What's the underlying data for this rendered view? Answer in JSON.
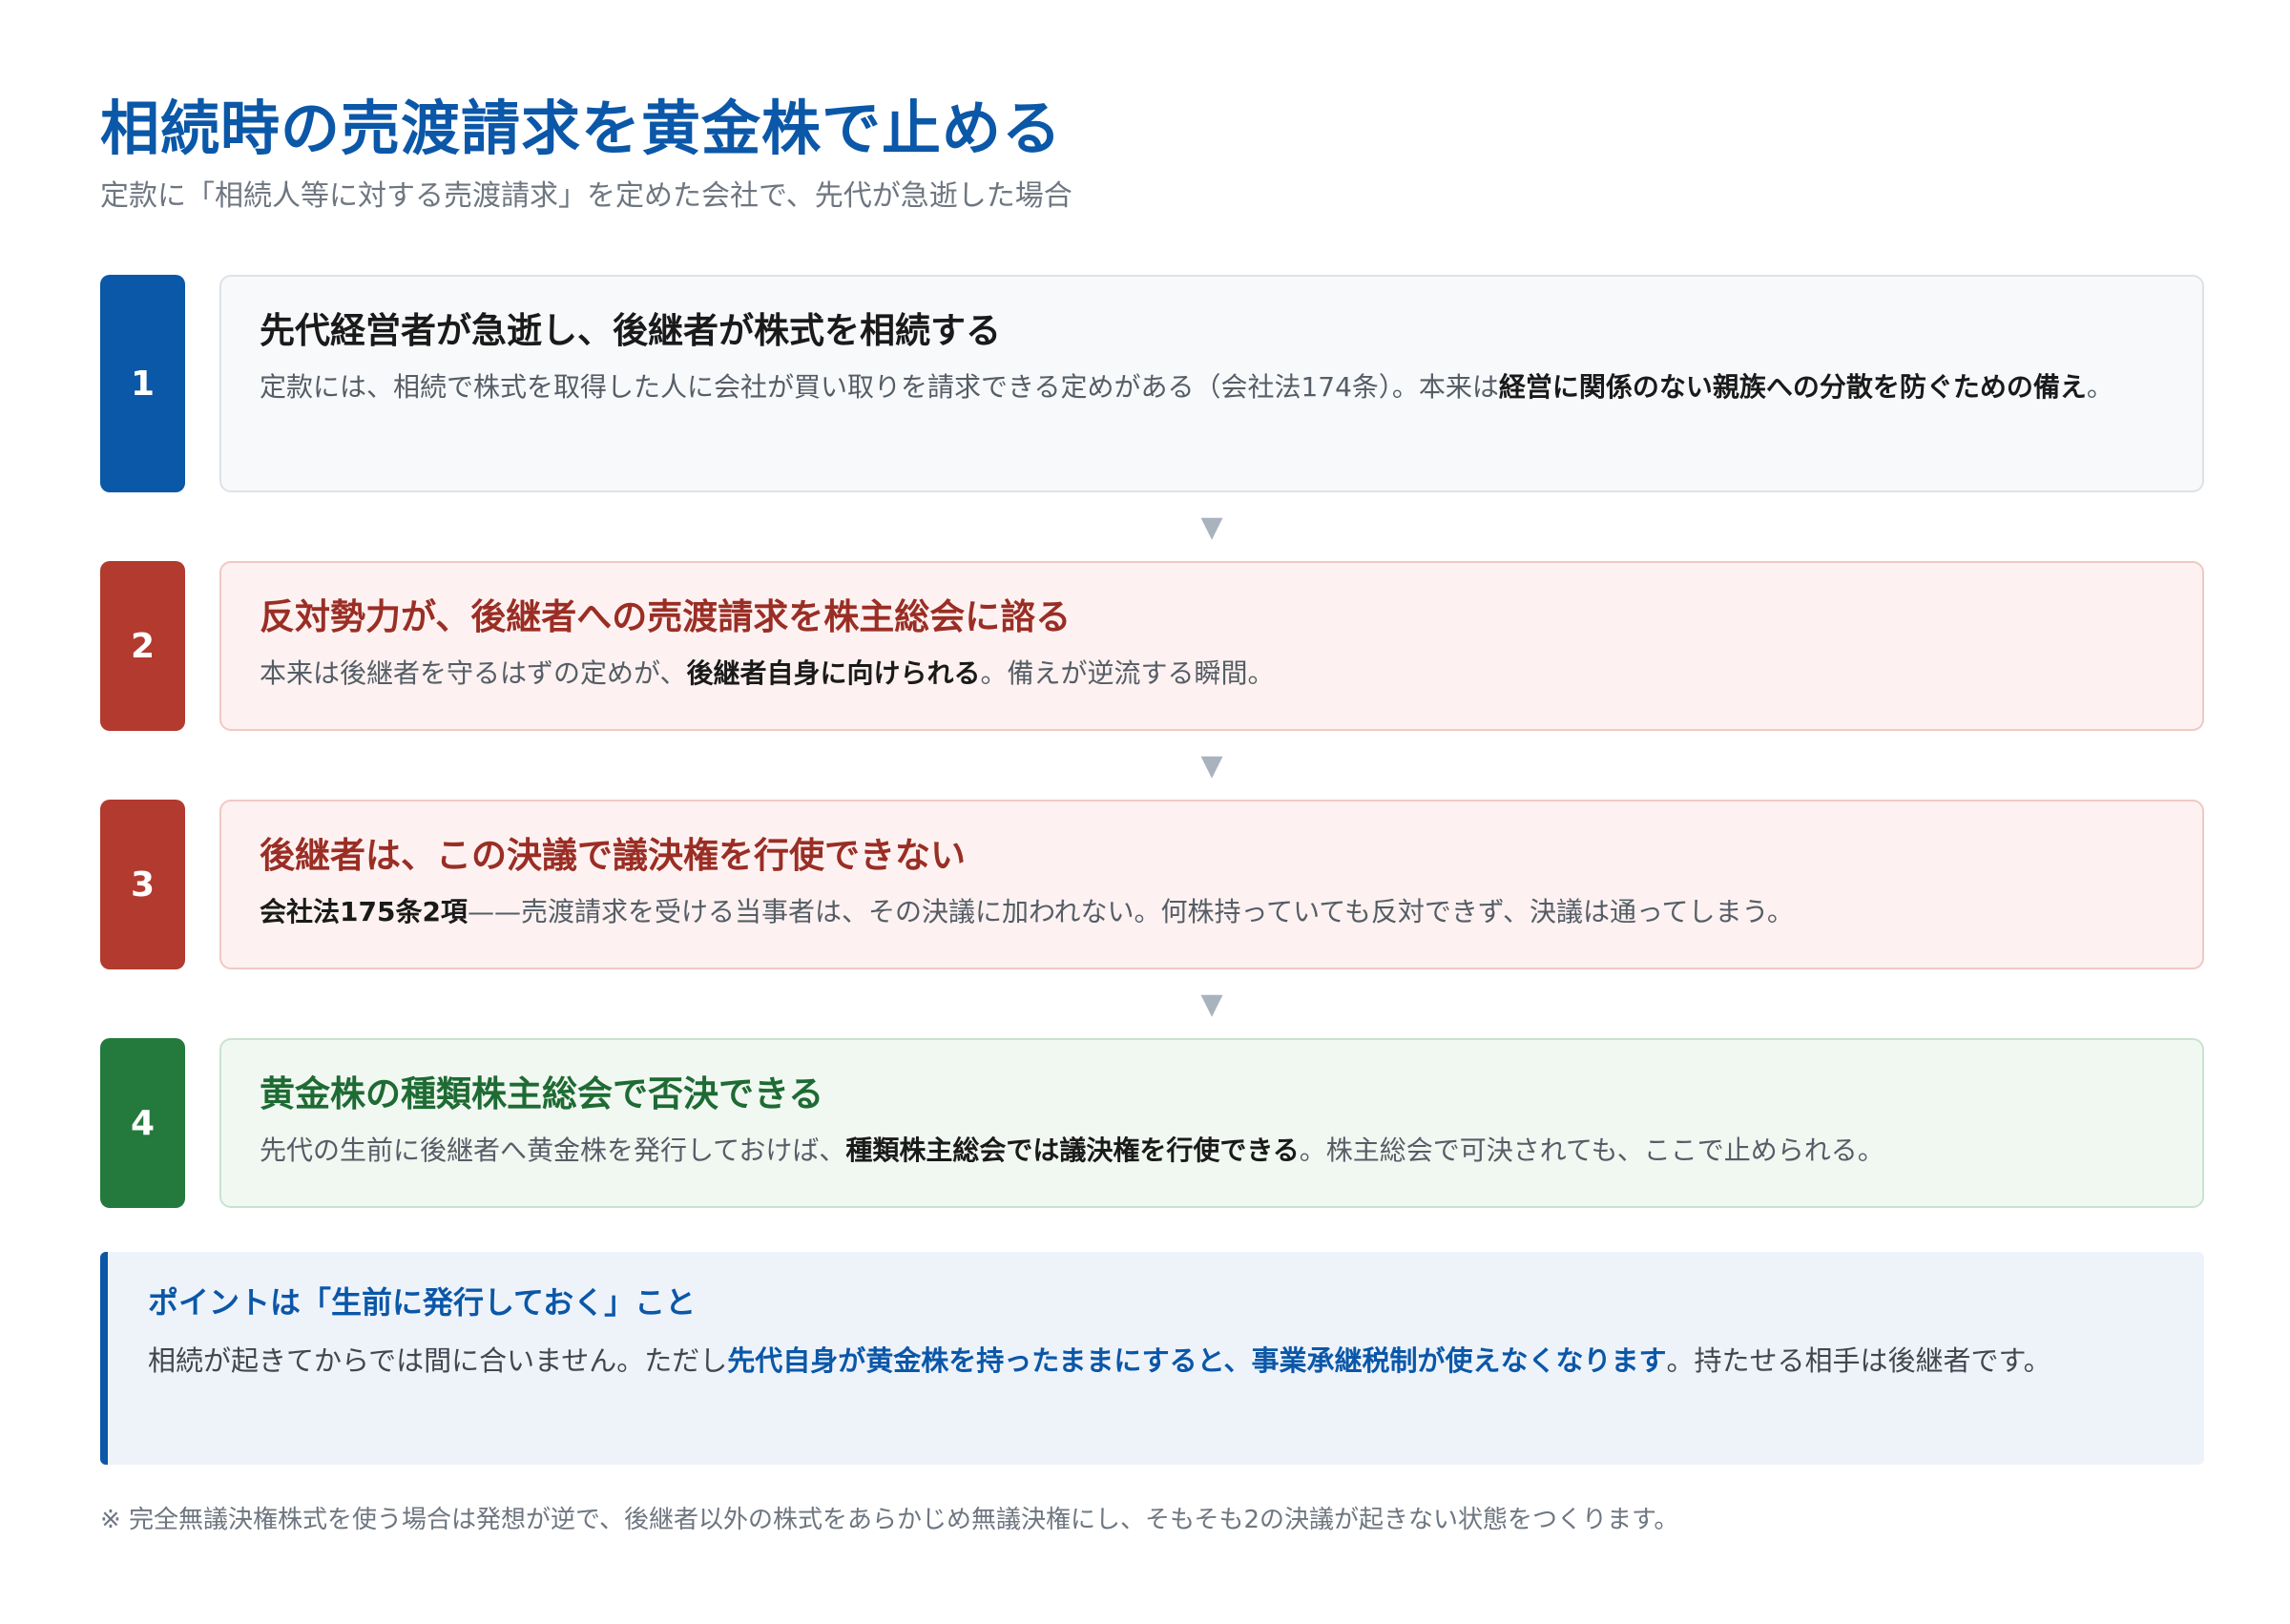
{
  "header": {
    "title": "相続時の売渡請求を黄金株で止める",
    "subtitle": "定款に「相続人等に対する売渡請求」を定めた会社で、先代が急逝した場合"
  },
  "steps": [
    {
      "number": "1",
      "title": "先代経営者が急逝し、後継者が株式を相続する",
      "text_before": "定款には、相続で株式を取得した人に会社が買い取りを請求できる定めがある（会社法174条）。本来は",
      "text_bold": "経営に関係のない親族への分散を防ぐための備え",
      "text_after": "。"
    },
    {
      "number": "2",
      "title": "反対勢力が、後継者への売渡請求を株主総会に諮る",
      "text_before": "本来は後継者を守るはずの定めが、",
      "text_bold": "後継者自身に向けられる",
      "text_after": "。備えが逆流する瞬間。"
    },
    {
      "number": "3",
      "title": "後継者は、この決議で議決権を行使できない",
      "text_bold": "会社法175条2項",
      "text_after": "——売渡請求を受ける当事者は、その決議に加われない。何株持っていても反対できず、決議は通ってしまう。"
    },
    {
      "number": "4",
      "title": "黄金株の種類株主総会で否決できる",
      "text_before": "先代の生前に後継者へ黄金株を発行しておけば、",
      "text_bold": "種類株主総会では議決権を行使できる",
      "text_after": "。株主総会で可決されても、ここで止められる。"
    }
  ],
  "arrow_glyph": "▼",
  "point": {
    "title": "ポイントは「生前に発行しておく」こと",
    "text_before": "相続が起きてからでは間に合いません。ただし",
    "text_bold": "先代自身が黄金株を持ったままにすると、事業承継税制が使えなくなります",
    "text_after": "。持たせる相手は後継者です。"
  },
  "note": "※ 完全無議決権株式を使う場合は発想が逆で、後継者以外の株式をあらかじめ無議決権にし、そもそも2の決議が起きない状態をつくります。",
  "colors": {
    "primary_blue": "#0b57a8",
    "warning_red": "#b23a2f",
    "success_green": "#237a3c"
  }
}
